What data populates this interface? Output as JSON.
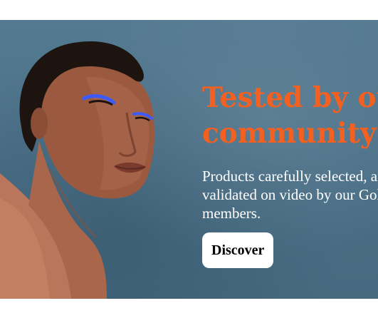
{
  "hero": {
    "title": "Tested by our community",
    "subtitle": "Products carefully selected, and validated on video by our Gold members.",
    "cta_label": "Discover",
    "colors": {
      "background": "#4d7289",
      "title": "#f4601f",
      "subtitle": "#ffffff",
      "button_bg": "#ffffff",
      "button_text": "#000000"
    },
    "image": "portrait-of-woman-with-blue-eyeliner"
  }
}
